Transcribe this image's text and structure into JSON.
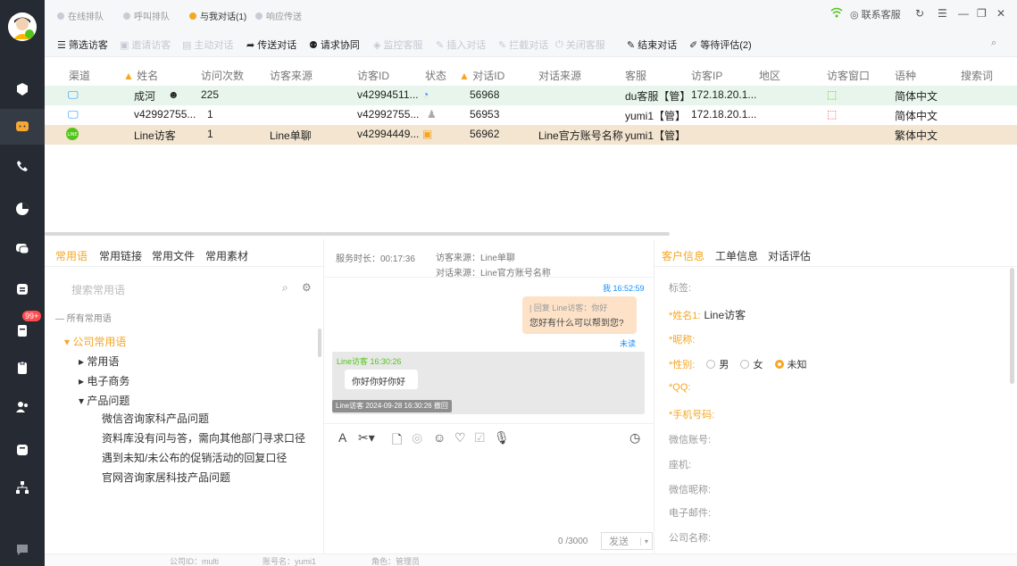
{
  "status_tabs": [
    {
      "label": "在线排队",
      "color": "#c8ccd4"
    },
    {
      "label": "呼叫排队",
      "color": "#c8ccd4"
    },
    {
      "label": "与我对话(1)",
      "color": "#f5a623"
    },
    {
      "label": "响应传送",
      "color": "#c8ccd4"
    }
  ],
  "window": {
    "support_label": "联系客服"
  },
  "toolbar": [
    {
      "label": "筛选访客",
      "icon": "list-icon",
      "enabled": true
    },
    {
      "label": "邀请访客",
      "icon": "invite-icon",
      "enabled": false
    },
    {
      "label": "主动对话",
      "icon": "chat-icon",
      "enabled": false
    },
    {
      "label": "传送对话",
      "icon": "forward-icon",
      "enabled": true
    },
    {
      "label": "请求协同",
      "icon": "users-icon",
      "enabled": true
    },
    {
      "label": "监控客服",
      "icon": "monitor-icon",
      "enabled": false
    },
    {
      "label": "插入对话",
      "icon": "insert-icon",
      "enabled": false
    },
    {
      "label": "拦截对话",
      "icon": "intercept-icon",
      "enabled": false
    },
    {
      "label": "关闭客服",
      "icon": "power-icon",
      "enabled": false
    },
    {
      "label": "结束对话",
      "icon": "end-icon",
      "enabled": true
    },
    {
      "label": "等待评估(2)",
      "icon": "pen-icon",
      "enabled": true
    }
  ],
  "table": {
    "columns": [
      "渠道",
      "姓名",
      "访问次数",
      "访客来源",
      "访客ID",
      "状态",
      "对话ID",
      "对话来源",
      "客服",
      "访客IP",
      "地区",
      "访客窗口",
      "语种",
      "搜索词"
    ],
    "rows": [
      {
        "channel": "monitor-icon",
        "name": "成河",
        "visits": "225",
        "source": "",
        "visitor_id": "v42994511...",
        "dialog_id": "56968",
        "dialog_source": "",
        "agent": "du客服【管】",
        "ip": "172.18.20.1...",
        "region": "",
        "language": "简体中文",
        "bg": "#e8f5ec"
      },
      {
        "channel": "monitor-icon",
        "name": "v42992755...",
        "visits": "1",
        "source": "",
        "visitor_id": "v42992755...",
        "dialog_id": "56953",
        "dialog_source": "",
        "agent": "yumi1【管】",
        "ip": "172.18.20.1...",
        "region": "",
        "language": "简体中文",
        "bg": "#ffffff"
      },
      {
        "channel": "line-icon",
        "name": "Line访客",
        "visits": "1",
        "source": "Line单聊",
        "visitor_id": "v42994449...",
        "dialog_id": "56962",
        "dialog_source": "Line官方账号名称",
        "agent": "yumi1【管】",
        "ip": "",
        "region": "",
        "language": "繁体中文",
        "bg": "#f3e5d0"
      }
    ]
  },
  "left_panel": {
    "tabs": [
      "常用语",
      "常用链接",
      "常用文件",
      "常用素材"
    ],
    "search_placeholder": "搜索常用语",
    "all_label": "所有常用语",
    "group": "公司常用语",
    "items": [
      "常用语",
      "电子商务",
      "产品问题"
    ],
    "phrases": [
      "微信咨询家科产品问题",
      "资料库没有问与答，需向其他部门寻求口径",
      "遇到未知/未公布的促销活动的回复口径",
      "官网咨询家居科技产品问题"
    ]
  },
  "chat": {
    "duration_label": "服务时长：00:17:36",
    "visitor_source_label": "访客来源：Line单聊",
    "dialog_source_label": "对话来源：Line官方账号名称",
    "me_label": "我 16:52:59",
    "reply_quote": "| 回复 Line访客：你好",
    "reply_text": "您好有什么可以帮到您?",
    "unread_label": "未读",
    "visitor_label": "Line访客 16:30:26",
    "visitor_text": "你好你好你好",
    "recall_label": "Line访客 2024-09-28 16:30:26 撤回",
    "counter": "0 /3000",
    "send_label": "发送"
  },
  "right_panel": {
    "tabs": [
      "客户信息",
      "工单信息",
      "对话评估"
    ],
    "tag_label": "标签:",
    "name_label": "*姓名1:",
    "name_value": "Line访客",
    "nickname_label": "*昵称:",
    "gender_label": "*性别:",
    "gender_options": [
      "男",
      "女",
      "未知"
    ],
    "qq_label": "*QQ:",
    "phone_label": "*手机号码:",
    "wechat_label": "微信账号:",
    "landline_label": "座机:",
    "wechat_nick_label": "微信昵称:",
    "email_label": "电子邮件:",
    "company_label": "公司名称:"
  },
  "footer": {
    "company": "公司ID：multi",
    "account": "账号名：yumi1",
    "role": "角色：管理员"
  }
}
